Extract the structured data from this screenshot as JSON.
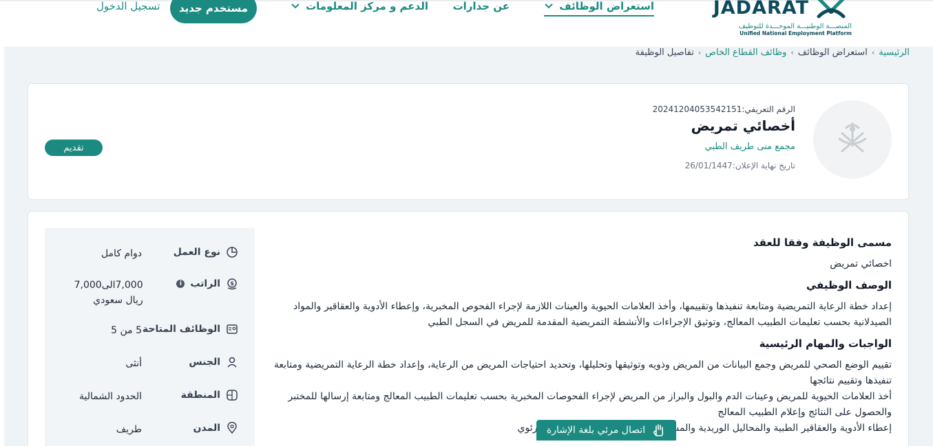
{
  "brand": {
    "name": "JADARAT",
    "tagline_ar": "المنصـــة الوطنيـــة الموحـــدة للتوظيف",
    "tagline_en": "Unified National Employment Platform",
    "primary_color": "#1b8a80",
    "dark_color": "#0e4a5c"
  },
  "nav": {
    "items": [
      {
        "label": "استعراض الوظائف",
        "active": true,
        "has_dropdown": true
      },
      {
        "label": "عن جدارات",
        "active": false,
        "has_dropdown": false
      },
      {
        "label": "الدعم و مركز المعلومات",
        "active": false,
        "has_dropdown": true
      }
    ],
    "new_user": "مستخدم جديد",
    "login": "تسجيل الدخول"
  },
  "breadcrumb": [
    "الرئيسية",
    "استعراض الوظائف",
    "وظائف القطاع الخاص",
    "تفاصيل الوظيفة"
  ],
  "job": {
    "id_label": "الرقم التعريفي:",
    "id_value": "20241204053542151",
    "title": "أخصائي تمريض",
    "company": "مجمع منى طريف الطبي",
    "deadline_label": "تاريخ نهاية الإعلان:",
    "deadline_value": "26/01/1447",
    "apply": "تقديم"
  },
  "details": {
    "contract_title_heading": "مسمى الوظيفة وفقا للعقد",
    "contract_title": "اخصائي تمريض",
    "description_heading": "الوصف الوظيفي",
    "description": "إعداد خطة الرعاية التمريضية ومتابعة تنفيذها وتقييمها، وأخذ العلامات الحيوية والعينات اللازمة لإجراء الفحوص المخبرية، وإعطاء الأدوية والعقاقير والمواد الصيدلانية بحسب تعليمات الطبيب المعالج، وتوثيق الإجراءات والأنشطة التمريضية المقدمة للمريض في السجل الطبي",
    "duties_heading": "الواجبات والمهام الرئيسية",
    "duties": [
      "تقييم الوضع الصحي للمريض وجمع البيانات من المريض وذويه وتوثيقها وتحليلها، وتحديد احتياجات المريض من الرعاية، وإعداد خطة الرعاية التمريضية ومتابعة تنفيذها وتقييم نتائجها",
      "أخذ العلامات الحيوية للمريض وعينات الدم والبول والبراز من المريض لإجراء الفحوصات المخبرية بحسب تعليمات الطبيب المعالج ومتابعة إرسالها للمختبر والحصول على النتائج وإعلام الطبيب المعالج",
      "إعطاء الأدوية والعقاقير الطبية والمحاليل الوريدية والمشاركة في عملية الإنعاش القلبي والرئوي"
    ]
  },
  "attributes": [
    {
      "label": "نوع العمل",
      "value": "دوام كامل",
      "icon": "clock-icon"
    },
    {
      "label": "الراتب",
      "value": "7,000الى7,000 ريال سعودي",
      "icon": "money-icon",
      "info": "i"
    },
    {
      "label": "الوظائف المتاحة",
      "value": "5 من 5",
      "icon": "id-card-icon"
    },
    {
      "label": "الجنس",
      "value": "أنثى",
      "icon": "gender-icon"
    },
    {
      "label": "المنطقة",
      "value": "الحدود الشمالية",
      "icon": "map-icon"
    },
    {
      "label": "المدن",
      "value": "طريف",
      "icon": "location-pin-icon"
    }
  ],
  "sign_language": "اتصال مرئي بلغة الإشارة"
}
